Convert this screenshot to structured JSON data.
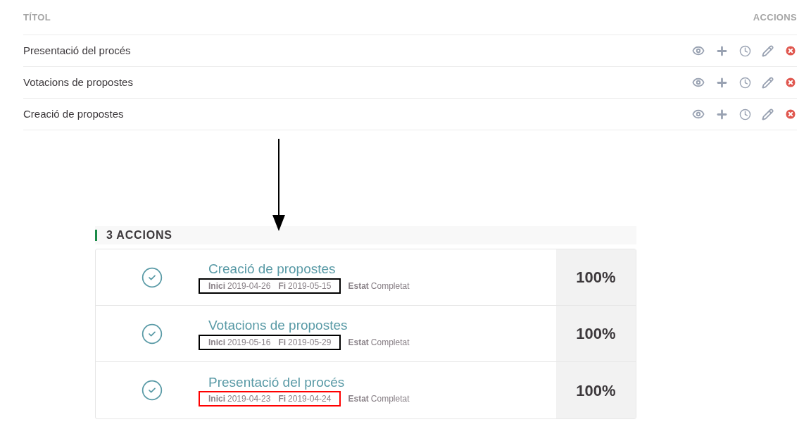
{
  "table": {
    "columns": [
      "TÍTOL",
      "ACCIONS"
    ],
    "rows": [
      {
        "title": "Presentació del procés"
      },
      {
        "title": "Votacions de propostes"
      },
      {
        "title": "Creació de propostes"
      }
    ]
  },
  "actions_panel": {
    "heading": "3 ACCIONS",
    "items": [
      {
        "title": "Creació de propostes",
        "start_label": "Inici",
        "start": "2019-04-26",
        "end_label": "Fi",
        "end": "2019-05-15",
        "status_label": "Estat",
        "status": "Completat",
        "percent": "100%",
        "color": "#000000"
      },
      {
        "title": "Votacions de propostes",
        "start_label": "Inici",
        "start": "2019-05-16",
        "end_label": "Fi",
        "end": "2019-05-29",
        "status_label": "Estat",
        "status": "Completat",
        "percent": "100%",
        "color": "#000000"
      },
      {
        "title": "Presentació del procés",
        "start_label": "Inici",
        "start": "2019-04-23",
        "end_label": "Fi",
        "end": "2019-04-24",
        "status_label": "Estat",
        "status": "Completat",
        "percent": "100%",
        "color": "#ff0000"
      }
    ]
  }
}
